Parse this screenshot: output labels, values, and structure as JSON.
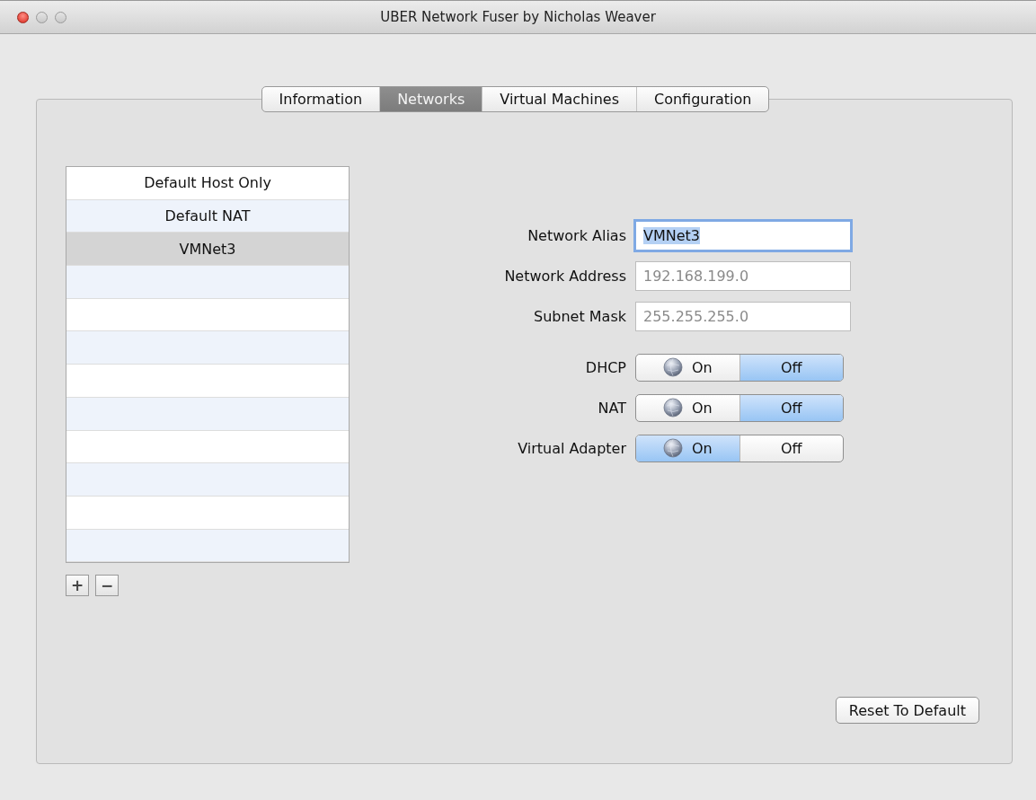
{
  "window": {
    "title": "UBER Network Fuser by Nicholas Weaver"
  },
  "tabs": [
    {
      "label": "Information",
      "selected": false
    },
    {
      "label": "Networks",
      "selected": true
    },
    {
      "label": "Virtual Machines",
      "selected": false
    },
    {
      "label": "Configuration",
      "selected": false
    }
  ],
  "network_list": [
    {
      "label": "Default Host Only",
      "selected": false
    },
    {
      "label": "Default NAT",
      "selected": false
    },
    {
      "label": "VMNet3",
      "selected": true
    }
  ],
  "list_buttons": [
    "+",
    "−"
  ],
  "fields": [
    {
      "label": "Network Alias",
      "value": "VMNet3",
      "focused": true,
      "disabled": false
    },
    {
      "label": "Network Address",
      "value": "192.168.199.0",
      "focused": false,
      "disabled": true
    },
    {
      "label": "Subnet Mask",
      "value": "255.255.255.0",
      "focused": false,
      "disabled": true
    }
  ],
  "toggles": [
    {
      "label": "DHCP",
      "segments": [
        {
          "label": "On",
          "selected": false
        },
        {
          "label": "Off",
          "selected": true
        }
      ]
    },
    {
      "label": "NAT",
      "segments": [
        {
          "label": "On",
          "selected": false
        },
        {
          "label": "Off",
          "selected": true
        }
      ]
    },
    {
      "label": "Virtual Adapter",
      "segments": [
        {
          "label": "On",
          "selected": true
        },
        {
          "label": "Off",
          "selected": false
        }
      ]
    }
  ],
  "reset_button": "Reset To Default"
}
